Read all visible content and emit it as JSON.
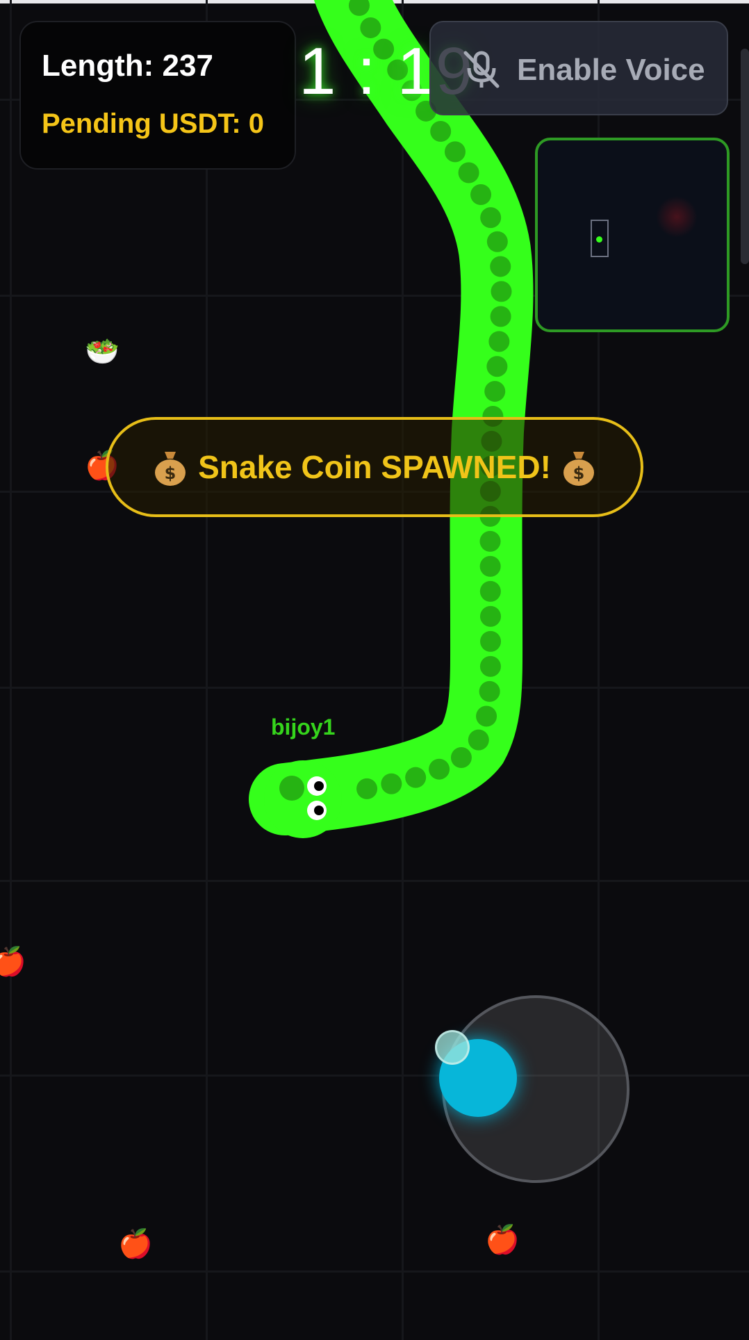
{
  "hud": {
    "length_label": "Length: 237",
    "pending_usdt_label": "Pending USDT: 0",
    "timer": "1 : 19"
  },
  "voice_button": {
    "label": "Enable Voice",
    "icon": "mic-off-icon"
  },
  "minimap": {
    "label": "minimap"
  },
  "banner": {
    "text": "Snake Coin SPAWNED!",
    "icon": "money-bag-icon"
  },
  "player": {
    "name": "bijoy1",
    "length": 237
  },
  "food": [
    {
      "type": "bowl-food-icon",
      "glyph": "🥗"
    },
    {
      "type": "apple-icon",
      "glyph": "🍎"
    },
    {
      "type": "apple-icon",
      "glyph": "🍎"
    },
    {
      "type": "apple-icon",
      "glyph": "🍎"
    },
    {
      "type": "apple-icon",
      "glyph": "🍎"
    }
  ],
  "colors": {
    "snake_body": "#35ff1b",
    "snake_spot": "#26b313",
    "banner_gold": "#e7be18",
    "usdt_yellow": "#f5c518",
    "joystick_knob": "#07b6d9",
    "minimap_border": "#2e9a24",
    "background": "#0b0b0e"
  }
}
